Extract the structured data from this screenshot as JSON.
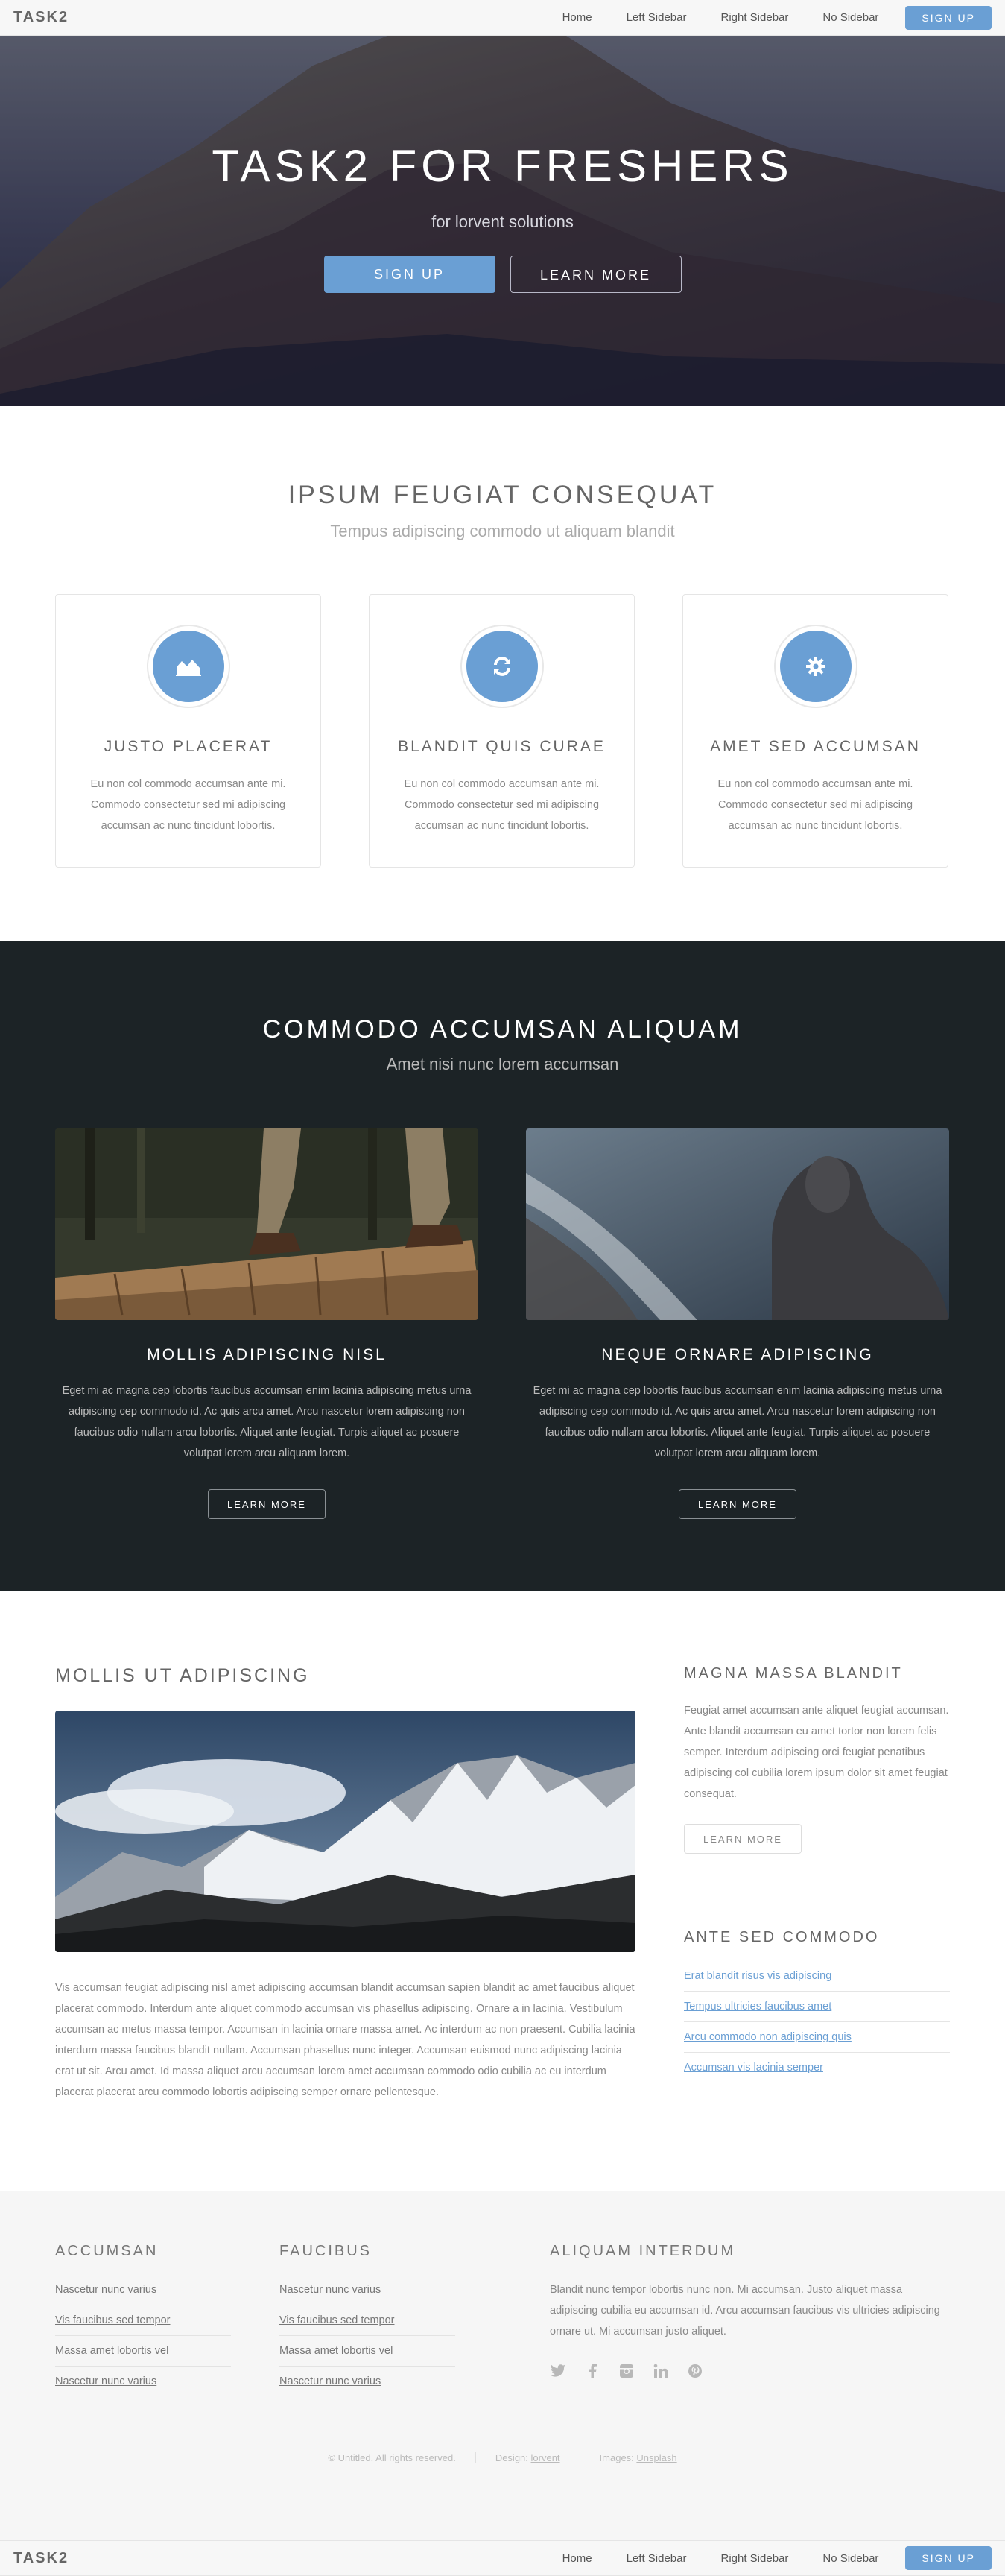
{
  "header": {
    "logo": "TASK2",
    "nav": [
      "Home",
      "Left Sidebar",
      "Right Sidebar",
      "No Sidebar"
    ],
    "signup": "SIGN UP"
  },
  "banner": {
    "title": "TASK2 FOR FRESHERS",
    "subtitle": "for lorvent solutions",
    "primary_button": "SIGN UP",
    "secondary_button": "LEARN MORE"
  },
  "section1": {
    "title": "IPSUM FEUGIAT CONSEQUAT",
    "subtitle": "Tempus adipiscing commodo ut aliquam blandit",
    "features": [
      {
        "icon": "area-chart-icon",
        "title": "JUSTO PLACERAT",
        "text": "Eu non col commodo accumsan ante mi. Commodo consectetur sed mi adipiscing accumsan ac nunc tincidunt lobortis."
      },
      {
        "icon": "refresh-icon",
        "title": "BLANDIT QUIS CURAE",
        "text": "Eu non col commodo accumsan ante mi. Commodo consectetur sed mi adipiscing accumsan ac nunc tincidunt lobortis."
      },
      {
        "icon": "gear-icon",
        "title": "AMET SED ACCUMSAN",
        "text": "Eu non col commodo accumsan ante mi. Commodo consectetur sed mi adipiscing accumsan ac nunc tincidunt lobortis."
      }
    ]
  },
  "section2": {
    "title": "COMMODO ACCUMSAN ALIQUAM",
    "subtitle": "Amet nisi nunc lorem accumsan",
    "columns": [
      {
        "title": "MOLLIS ADIPISCING NISL",
        "text": "Eget mi ac magna cep lobortis faucibus accumsan enim lacinia adipiscing metus urna adipiscing cep commodo id. Ac quis arcu amet. Arcu nascetur lorem adipiscing non faucibus odio nullam arcu lobortis. Aliquet ante feugiat. Turpis aliquet ac posuere volutpat lorem arcu aliquam lorem.",
        "button": "LEARN MORE"
      },
      {
        "title": "NEQUE ORNARE ADIPISCING",
        "text": "Eget mi ac magna cep lobortis faucibus accumsan enim lacinia adipiscing metus urna adipiscing cep commodo id. Ac quis arcu amet. Arcu nascetur lorem adipiscing non faucibus odio nullam arcu lobortis. Aliquet ante feugiat. Turpis aliquet ac posuere volutpat lorem arcu aliquam lorem.",
        "button": "LEARN MORE"
      }
    ]
  },
  "section3": {
    "main_title": "MOLLIS UT ADIPISCING",
    "main_text": "Vis accumsan feugiat adipiscing nisl amet adipiscing accumsan blandit accumsan sapien blandit ac amet faucibus aliquet placerat commodo. Interdum ante aliquet commodo accumsan vis phasellus adipiscing. Ornare a in lacinia. Vestibulum accumsan ac metus massa tempor. Accumsan in lacinia ornare massa amet. Ac interdum ac non praesent. Cubilia lacinia interdum massa faucibus blandit nullam. Accumsan phasellus nunc integer. Accumsan euismod nunc adipiscing lacinia erat ut sit. Arcu amet. Id massa aliquet arcu accumsan lorem amet accumsan commodo odio cubilia ac eu interdum placerat placerat arcu commodo lobortis adipiscing semper ornare pellentesque.",
    "side_title": "MAGNA MASSA BLANDIT",
    "side_text": "Feugiat amet accumsan ante aliquet feugiat accumsan. Ante blandit accumsan eu amet tortor non lorem felis semper. Interdum adipiscing orci feugiat penatibus adipiscing col cubilia lorem ipsum dolor sit amet feugiat consequat.",
    "side_button": "LEARN MORE",
    "side_title2": "ANTE SED COMMODO",
    "side_links": [
      "Erat blandit risus vis adipiscing",
      "Tempus ultricies faucibus amet",
      "Arcu commodo non adipiscing quis",
      "Accumsan vis lacinia semper"
    ]
  },
  "footer": {
    "col1_title": "ACCUMSAN",
    "col1_links": [
      "Nascetur nunc varius",
      "Vis faucibus sed tempor",
      "Massa amet lobortis vel",
      "Nascetur nunc varius"
    ],
    "col2_title": "FAUCIBUS",
    "col2_links": [
      "Nascetur nunc varius",
      "Vis faucibus sed tempor",
      "Massa amet lobortis vel",
      "Nascetur nunc varius"
    ],
    "about_title": "ALIQUAM INTERDUM",
    "about_text": "Blandit nunc tempor lobortis nunc non. Mi accumsan. Justo aliquet massa adipiscing cubilia eu accumsan id. Arcu accumsan faucibus vis ultricies adipiscing ornare ut. Mi accumsan justo aliquet.",
    "socials": [
      "twitter-icon",
      "facebook-icon",
      "instagram-icon",
      "linkedin-icon",
      "pinterest-icon"
    ],
    "copyright": "© Untitled. All rights reserved.",
    "design_label": "Design: ",
    "design_link": "lorvent",
    "images_label": "Images: ",
    "images_link": "Unsplash"
  }
}
